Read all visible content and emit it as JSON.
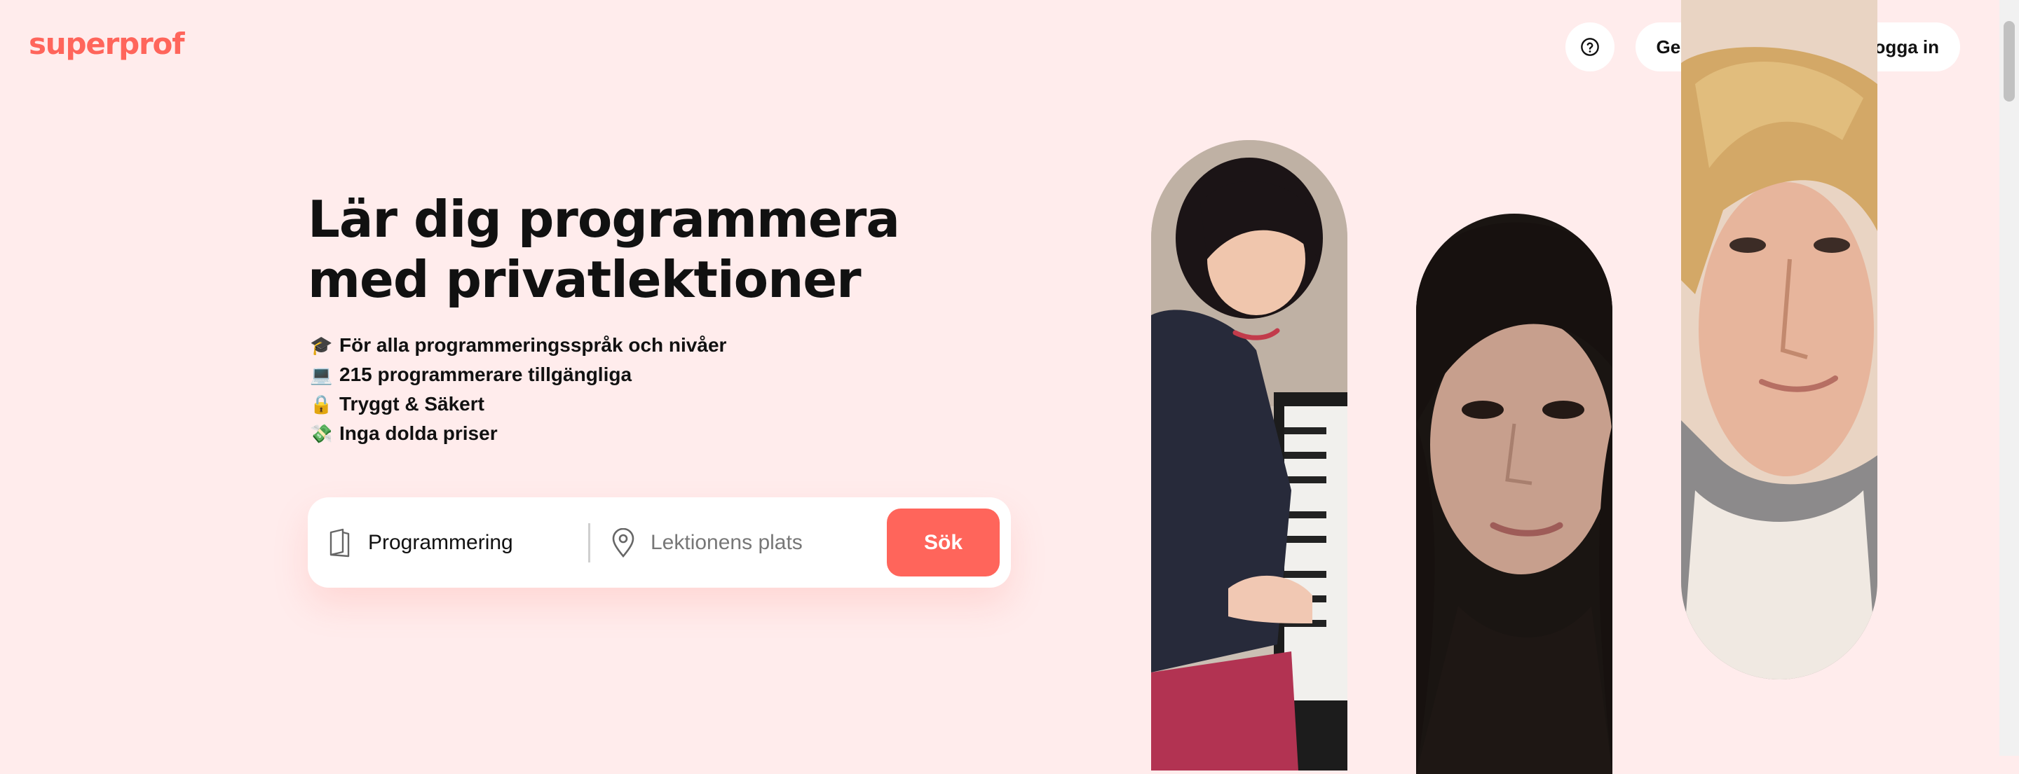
{
  "brand": {
    "logo_text": "superprof",
    "color": "#ff655b"
  },
  "header": {
    "help_icon": "question-circle-icon",
    "teach_label": "Ge undervisning",
    "login_label": "Logga in"
  },
  "hero": {
    "title": "Lär dig programmera med privatlektioner",
    "features": [
      {
        "emoji": "🎓",
        "icon": "graduation-cap-icon",
        "text": "För alla programmeringsspråk och nivåer"
      },
      {
        "emoji": "💻",
        "icon": "laptop-icon",
        "text": "215 programmerare tillgängliga"
      },
      {
        "emoji": "🔒",
        "icon": "lock-icon",
        "text": "Tryggt & Säkert"
      },
      {
        "emoji": "💸",
        "icon": "money-icon",
        "text": "Inga dolda priser"
      }
    ]
  },
  "search": {
    "subject_icon": "book-icon",
    "subject_value": "Programmering",
    "place_icon": "location-pin-icon",
    "place_placeholder": "Lektionens plats",
    "button_label": "Sök"
  },
  "photos": [
    {
      "name": "tutor-photo-piano",
      "description_icon": "person-photo"
    },
    {
      "name": "tutor-photo-woman",
      "description_icon": "person-photo"
    },
    {
      "name": "tutor-photo-man",
      "description_icon": "person-photo"
    }
  ],
  "colors": {
    "background": "#ffecec",
    "accent": "#ff655b",
    "text": "#111111"
  }
}
